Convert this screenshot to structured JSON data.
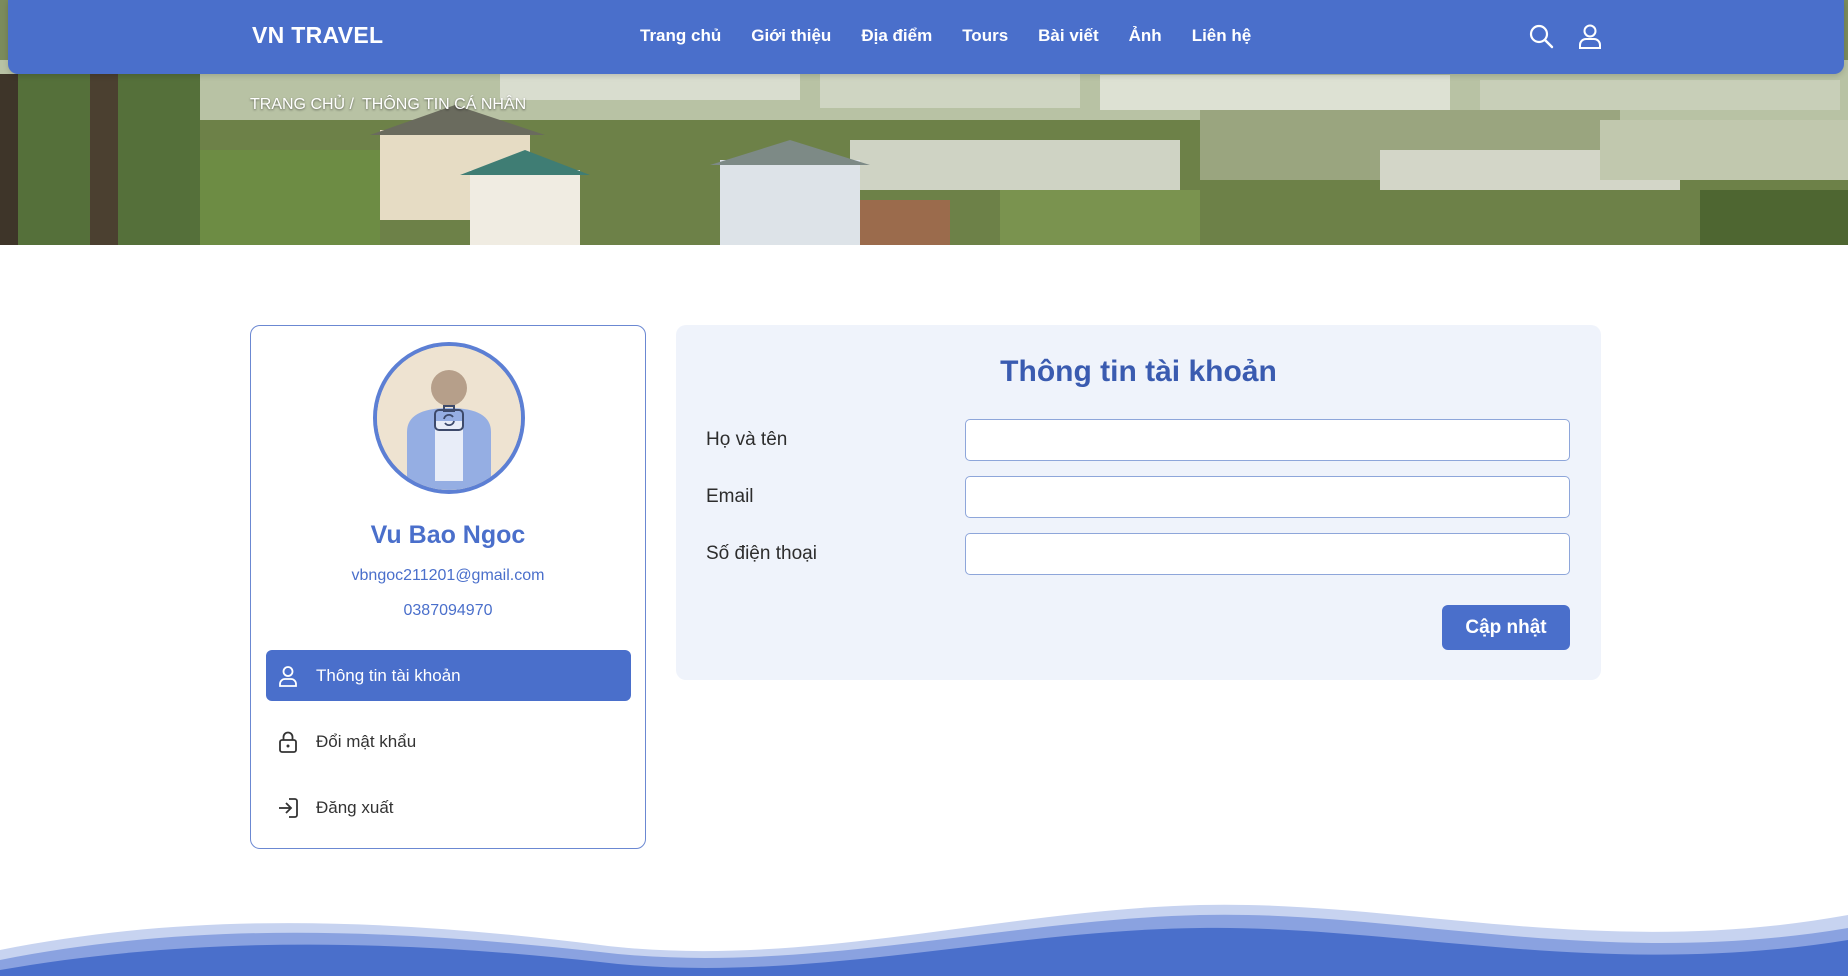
{
  "header": {
    "brand": "VN TRAVEL",
    "nav": [
      "Trang chủ",
      "Giới thiệu",
      "Địa điểm",
      "Tours",
      "Bài viết",
      "Ảnh",
      "Liên hệ"
    ],
    "icons": [
      "search-icon",
      "user-icon"
    ]
  },
  "breadcrumb": {
    "home": "TRANG CHỦ /",
    "current": "THÔNG TIN CÁ NHÂN"
  },
  "profile": {
    "name": "Vu Bao Ngoc",
    "email": "vbngoc211201@gmail.com",
    "phone": "0387094970",
    "avatar_overlay_icon": "camera-switch-icon"
  },
  "sidebar": {
    "items": [
      {
        "label": "Thông tin tài khoản",
        "icon": "user-icon",
        "active": true
      },
      {
        "label": "Đổi mật khẩu",
        "icon": "lock-icon",
        "active": false
      },
      {
        "label": "Đăng xuất",
        "icon": "logout-icon",
        "active": false
      }
    ]
  },
  "form": {
    "title": "Thông tin tài khoản",
    "fields": [
      {
        "label": "Họ và tên",
        "value": ""
      },
      {
        "label": "Email",
        "value": ""
      },
      {
        "label": "Số điện thoại",
        "value": ""
      }
    ],
    "submit_label": "Cập nhật"
  },
  "colors": {
    "primary": "#4a6fcb",
    "title": "#3a5bb0",
    "form_bg": "#eff3fb"
  }
}
